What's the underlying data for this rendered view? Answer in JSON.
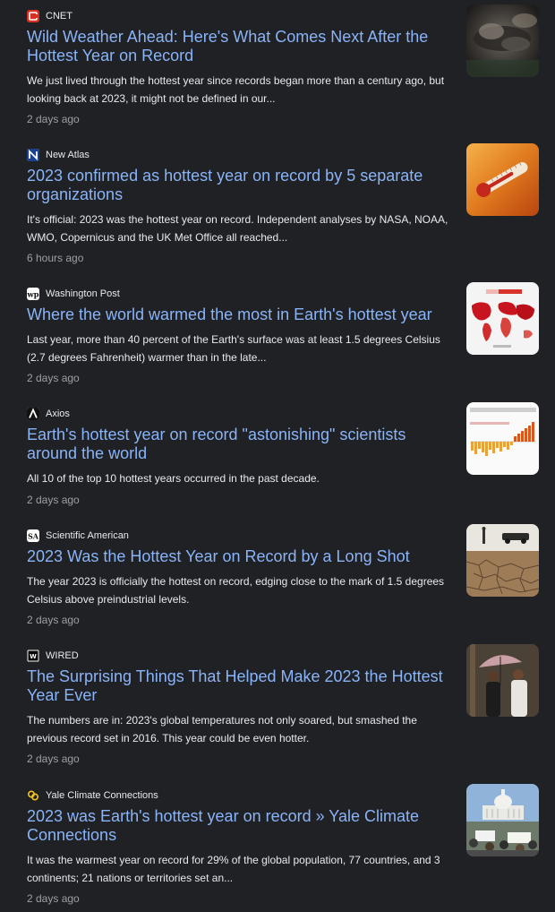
{
  "articles": [
    {
      "source": "CNET",
      "icon": "cnet-logo-icon",
      "headline": "Wild Weather Ahead: Here's What Comes Next After the Hottest Year on Record",
      "snippet": "We just lived through the hottest year since records began more than a century ago, but looking back at 2023, it might not be defined in our...",
      "age": "2 days ago",
      "thumbnail": "storm-clouds-thumbnail"
    },
    {
      "source": "New Atlas",
      "icon": "new-atlas-logo-icon",
      "headline": "2023 confirmed as hottest year on record by 5 separate organizations",
      "snippet": "It's official: 2023 was the hottest year on record. Independent analyses by NASA, NOAA, WMO, Copernicus and the UK Met Office all reached...",
      "age": "6 hours ago",
      "thumbnail": "thermometer-thumbnail"
    },
    {
      "source": "Washington Post",
      "icon": "washington-post-logo-icon",
      "headline": "Where the world warmed the most in Earth's hottest year",
      "snippet": "Last year, more than 40 percent of the Earth's surface was at least 1.5 degrees Celsius (2.7 degrees Fahrenheit) warmer than in the late...",
      "age": "2 days ago",
      "thumbnail": "world-heat-map-thumbnail"
    },
    {
      "source": "Axios",
      "icon": "axios-logo-icon",
      "headline": "Earth's hottest year on record \"astonishing\" scientists around the world",
      "snippet": "All 10 of the top 10 hottest years occurred in the past decade.",
      "age": "2 days ago",
      "thumbnail": "temperature-anomaly-chart-thumbnail"
    },
    {
      "source": "Scientific American",
      "icon": "scientific-american-logo-icon",
      "headline": "2023 Was the Hottest Year on Record by a Long Shot",
      "snippet": "The year 2023 is officially the hottest on record, edging close to the mark of 1.5 degrees Celsius above preindustrial levels.",
      "age": "2 days ago",
      "thumbnail": "cracked-earth-thumbnail"
    },
    {
      "source": "WIRED",
      "icon": "wired-logo-icon",
      "headline": "The Surprising Things That Helped Make 2023 the Hottest Year Ever",
      "snippet": "The numbers are in: 2023's global temperatures not only soared, but smashed the previous record set in 2016. This year could be even hotter.",
      "age": "2 days ago",
      "thumbnail": "people-with-umbrella-thumbnail"
    },
    {
      "source": "Yale Climate Connections",
      "icon": "yale-climate-connections-logo-icon",
      "headline": "2023 was Earth's hottest year on record » Yale Climate Connections",
      "snippet": "It was the warmest year on record for 29% of the global population, 77 countries, and 3 continents; 21 nations or territories set an...",
      "age": "2 days ago",
      "thumbnail": "capitol-protest-thumbnail"
    }
  ],
  "colors": {
    "background": "#202124",
    "headline": "#8ab4f8",
    "snippet": "#e8eaed",
    "age": "#9aa0a6"
  }
}
